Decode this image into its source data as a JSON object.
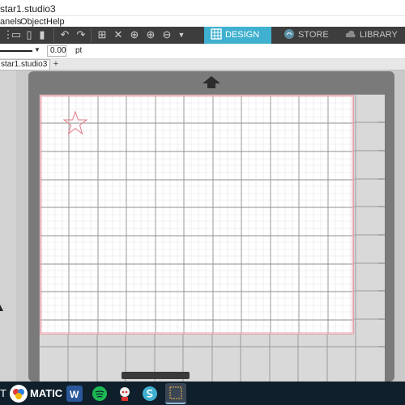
{
  "window": {
    "title": "star1.studio3"
  },
  "menu": {
    "items": [
      "anels",
      "Object",
      "Help"
    ]
  },
  "toolbar": {
    "tabs": [
      {
        "label": "DESIGN",
        "icon": "grid-icon",
        "active": true
      },
      {
        "label": "STORE",
        "icon": "store-icon",
        "active": false
      },
      {
        "label": "LIBRARY",
        "icon": "cloud-icon",
        "active": false
      }
    ],
    "accent": "#3fb0cf"
  },
  "linebar": {
    "line_width_value": "0.00",
    "unit": "pt"
  },
  "document_tabs": {
    "active": "star1.studio3",
    "add_label": "+"
  },
  "canvas": {
    "cut_border_color": "#e3a0a8",
    "shape": "star-outline"
  },
  "taskbar": {
    "text_left": "T",
    "text_brand": "MATIC"
  }
}
